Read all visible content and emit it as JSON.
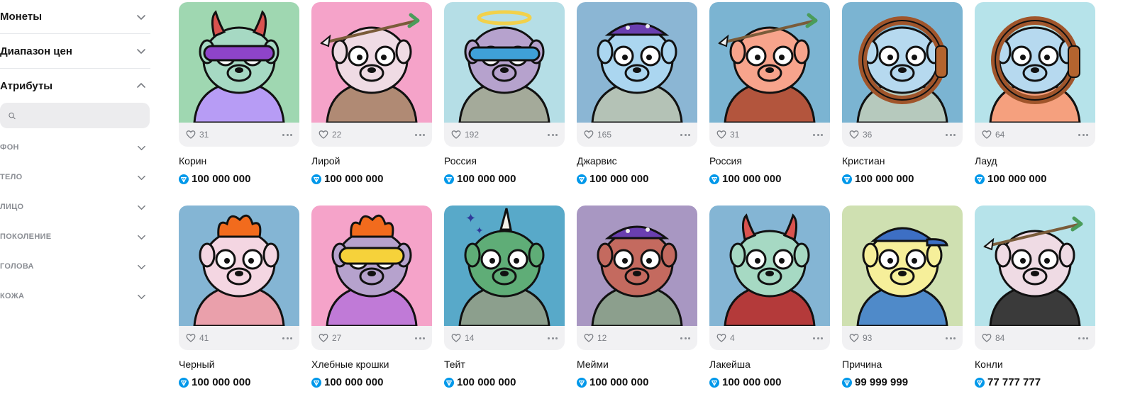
{
  "sidebar": {
    "sections": [
      {
        "label": "Монеты",
        "expanded": false
      },
      {
        "label": "Диапазон цен",
        "expanded": false
      },
      {
        "label": "Атрибуты",
        "expanded": true
      }
    ],
    "search": {
      "placeholder": "",
      "value": ""
    },
    "attributes": [
      "ФОН",
      "ТЕЛО",
      "ЛИЦО",
      "ПОКОЛЕНИЕ",
      "ГОЛОВА",
      "КОЖА"
    ]
  },
  "currency_icon": "ton-diamond-icon",
  "colors": {
    "ton_blue": "#0098ea",
    "card_bg": "#f1f1f3",
    "muted": "#8a8d93"
  },
  "items": [
    {
      "name": "Корин",
      "likes": "31",
      "price": "100 000 000",
      "bg": "#9fd7b1",
      "body": "#b79cf5",
      "head": "#a6d9c3",
      "accessory": "horns-mask"
    },
    {
      "name": "Лирой",
      "likes": "22",
      "price": "100 000 000",
      "bg": "#f5a3c9",
      "body": "#b08a74",
      "head": "#efdbe4",
      "accessory": "arrow-glasses"
    },
    {
      "name": "Россия",
      "likes": "192",
      "price": "100 000 000",
      "bg": "#b5dee6",
      "body": "#a4aa9a",
      "head": "#b6a2cd",
      "accessory": "halo-mask"
    },
    {
      "name": "Джарвис",
      "likes": "165",
      "price": "100 000 000",
      "bg": "#8bb6d4",
      "body": "#b4c2b6",
      "head": "#abd6f0",
      "accessory": "open-head"
    },
    {
      "name": "Россия",
      "likes": "31",
      "price": "100 000 000",
      "bg": "#7bb4d2",
      "body": "#b3553d",
      "head": "#f7a48c",
      "accessory": "arrow-glasses"
    },
    {
      "name": "Кристиан",
      "likes": "36",
      "price": "100 000 000",
      "bg": "#7bb4d2",
      "body": "#b6c9bd",
      "head": "#b6d9ef",
      "accessory": "diving-helmet"
    },
    {
      "name": "Лауд",
      "likes": "64",
      "price": "100 000 000",
      "bg": "#b6e3ea",
      "body": "#f5a07e",
      "head": "#b6d9ef",
      "accessory": "diving-helmet"
    },
    {
      "name": "Черный",
      "likes": "41",
      "price": "100 000 000",
      "bg": "#84b5d4",
      "body": "#eaa0ab",
      "head": "#f4d6e2",
      "accessory": "flame-hair"
    },
    {
      "name": "Хлебные крошки",
      "likes": "27",
      "price": "100 000 000",
      "bg": "#f5a3c9",
      "body": "#c07ad7",
      "head": "#b6a2cd",
      "accessory": "flame-visor"
    },
    {
      "name": "Тейт",
      "likes": "14",
      "price": "100 000 000",
      "bg": "#58a9c9",
      "body": "#8c9f8d",
      "head": "#5fad77",
      "accessory": "unicorn"
    },
    {
      "name": "Мейми",
      "likes": "12",
      "price": "100 000 000",
      "bg": "#a897c2",
      "body": "#8c9f8d",
      "head": "#c46a5f",
      "accessory": "open-head"
    },
    {
      "name": "Лакейша",
      "likes": "4",
      "price": "100 000 000",
      "bg": "#84b5d4",
      "body": "#b43a3a",
      "head": "#a6d9c3",
      "accessory": "horns"
    },
    {
      "name": "Причина",
      "likes": "93",
      "price": "99 999 999",
      "bg": "#cfe0b1",
      "body": "#4f8ac9",
      "head": "#f6ef9a",
      "accessory": "cap"
    },
    {
      "name": "Конли",
      "likes": "84",
      "price": "77 777 777",
      "bg": "#b6e3ea",
      "body": "#3a3a3a",
      "head": "#efdbe4",
      "accessory": "arrow-jacket"
    }
  ]
}
